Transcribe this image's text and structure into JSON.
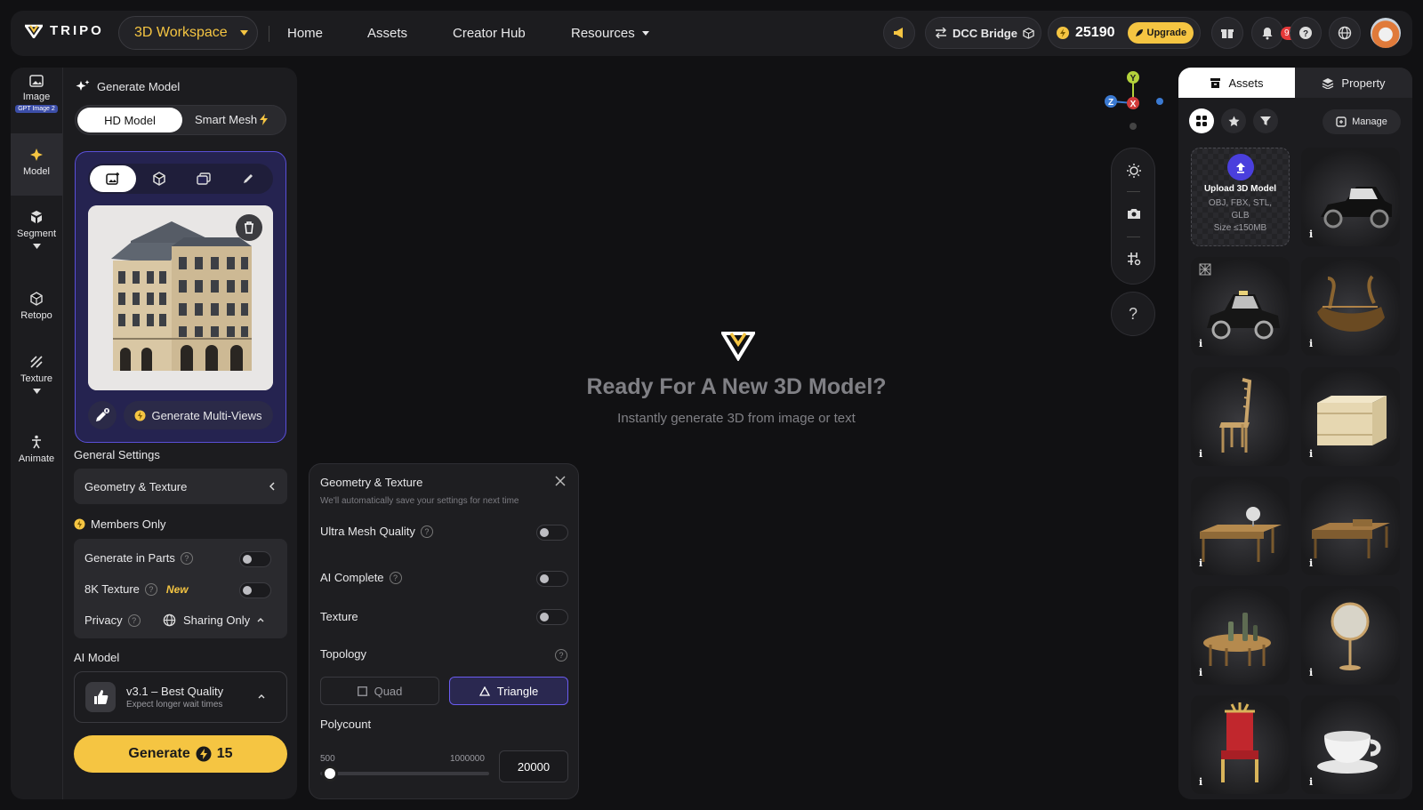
{
  "header": {
    "brand": "TRIPO",
    "workspace": "3D Workspace",
    "nav": [
      "Home",
      "Assets",
      "Creator Hub",
      "Resources"
    ],
    "dcc_bridge": "DCC Bridge",
    "credits": "25190",
    "upgrade": "Upgrade",
    "notif_badge": "99+"
  },
  "rail": [
    {
      "label": "Image",
      "badge": "GPT Image 2"
    },
    {
      "label": "Model"
    },
    {
      "label": "Segment"
    },
    {
      "label": "Retopo"
    },
    {
      "label": "Texture"
    },
    {
      "label": "Animate"
    }
  ],
  "panel": {
    "title": "Generate Model",
    "tab_hd": "HD Model",
    "tab_smart": "Smart Mesh",
    "multi_views": "Generate Multi-Views",
    "general_settings": "General Settings",
    "geometry_texture": "Geometry & Texture",
    "members_only": "Members Only",
    "generate_parts": "Generate in Parts",
    "texture_8k": "8K Texture",
    "new_tag": "New",
    "privacy": "Privacy",
    "privacy_value": "Sharing Only",
    "ai_model_label": "AI Model",
    "ai_model_name": "v3.1 – Best Quality",
    "ai_model_sub": "Expect longer wait times",
    "generate": "Generate",
    "generate_cost": "15"
  },
  "popup": {
    "title": "Geometry & Texture",
    "subtitle": "We'll automatically save your settings for next time",
    "ultra": "Ultra Mesh Quality",
    "ai_complete": "AI Complete",
    "texture": "Texture",
    "topology": "Topology",
    "quad": "Quad",
    "triangle": "Triangle",
    "polycount": "Polycount",
    "poly_min": "500",
    "poly_max": "1000000",
    "poly_value": "20000"
  },
  "canvas": {
    "title": "Ready For A New 3D Model?",
    "subtitle": "Instantly generate 3D from image or text",
    "help": "?",
    "axes": {
      "y": "Y",
      "z": "Z",
      "x": "X"
    }
  },
  "assets_panel": {
    "tab_assets": "Assets",
    "tab_property": "Property",
    "manage": "Manage",
    "upload_title": "Upload 3D Model",
    "upload_formats": "OBJ, FBX, STL, GLB",
    "upload_size": "Size ≤150MB",
    "info": "i"
  },
  "colors": {
    "accent": "#f5c542",
    "purple": "#5a4fd8",
    "bg": "#111113"
  }
}
